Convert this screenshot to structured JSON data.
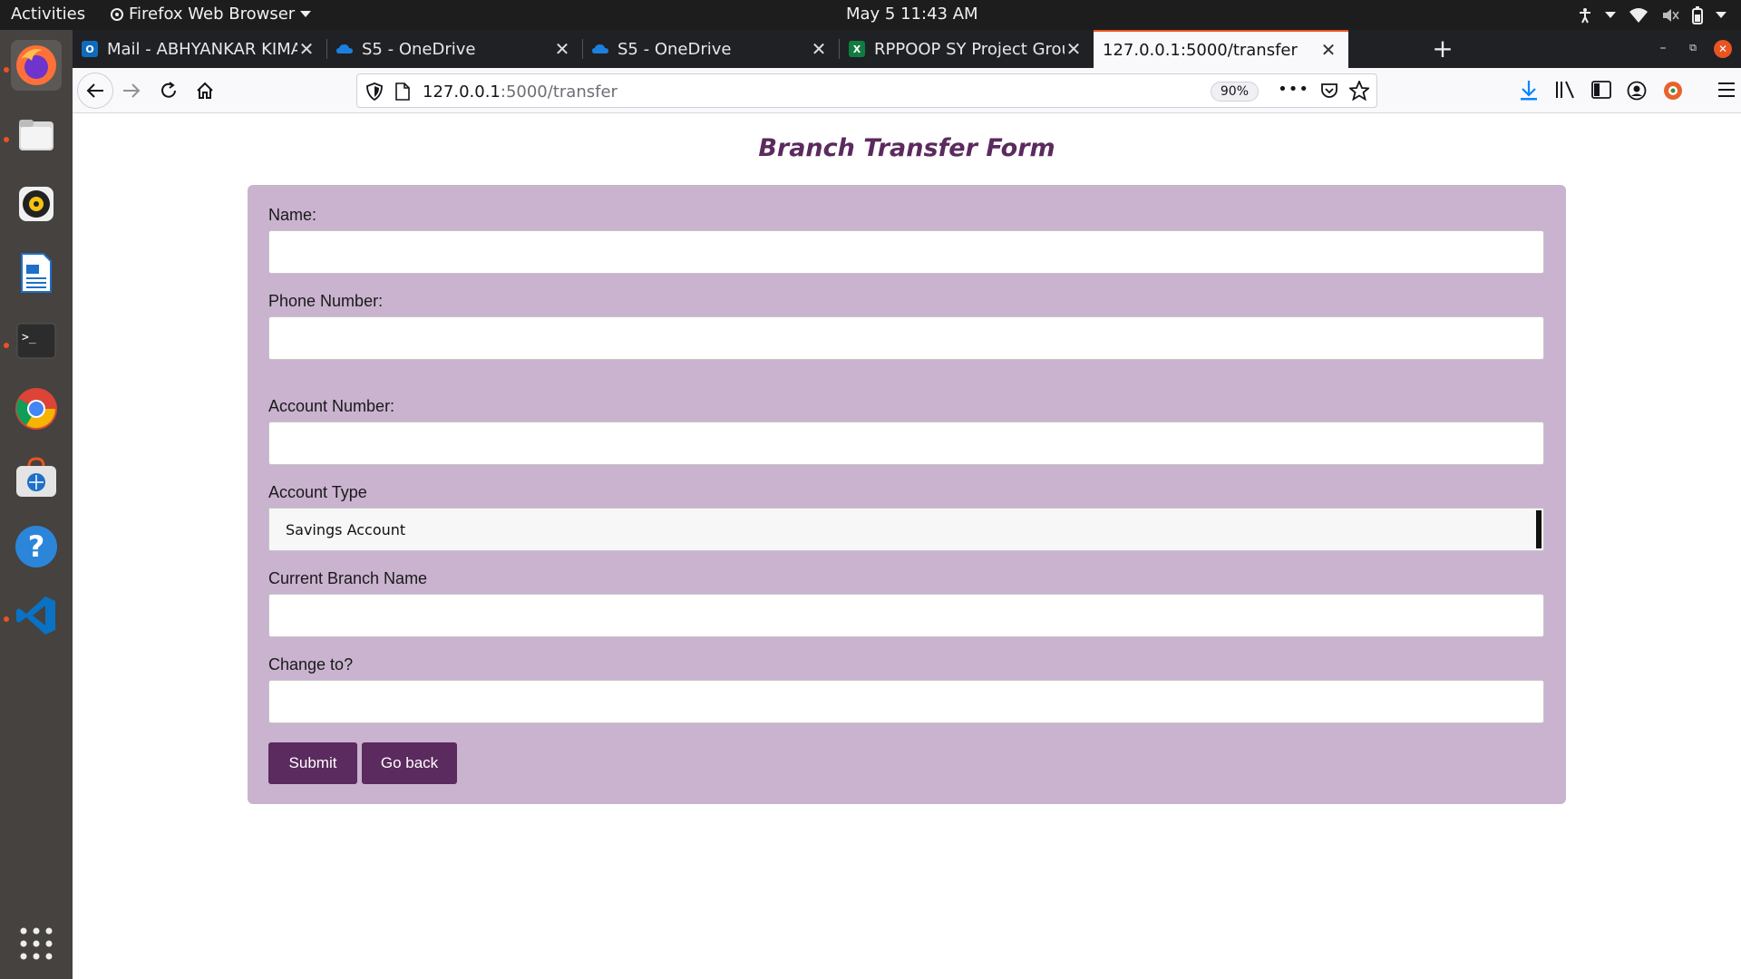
{
  "topbar": {
    "activities": "Activities",
    "app_name": "Firefox Web Browser",
    "clock": "May 5  11:43 AM"
  },
  "dock": {
    "items": [
      "firefox-icon",
      "files-icon",
      "rhythmbox-icon",
      "writer-icon",
      "terminal-icon",
      "chrome-icon",
      "software-icon",
      "help-icon",
      "vscode-icon"
    ],
    "show_apps_icon": "app-grid-icon"
  },
  "tabs": [
    {
      "title": "Mail - ABHYANKAR KIMA",
      "icon": "outlook-icon",
      "active": false
    },
    {
      "title": "S5 - OneDrive",
      "icon": "onedrive-icon",
      "active": false
    },
    {
      "title": "S5 - OneDrive",
      "icon": "onedrive-icon",
      "active": false
    },
    {
      "title": "RPPOOP SY Project Grou",
      "icon": "excel-icon",
      "active": false
    },
    {
      "title": "127.0.0.1:5000/transfer",
      "icon": "",
      "active": true
    }
  ],
  "navbar": {
    "url_host": "127.0.0.1",
    "url_path": ":5000/transfer",
    "zoom": "90%"
  },
  "form": {
    "title": "Branch Transfer Form",
    "name_label": "Name:",
    "phone_label": "Phone Number:",
    "account_number_label": "Account Number:",
    "account_type_label": "Account Type",
    "account_type_selected": "Savings Account",
    "current_branch_label": "Current Branch Name",
    "change_to_label": "Change to?",
    "submit_label": "Submit",
    "go_back_label": "Go back"
  },
  "colors": {
    "accent": "#5b2a5e",
    "card_bg": "#c9b3cf",
    "tab_active_border": "#e95420"
  }
}
